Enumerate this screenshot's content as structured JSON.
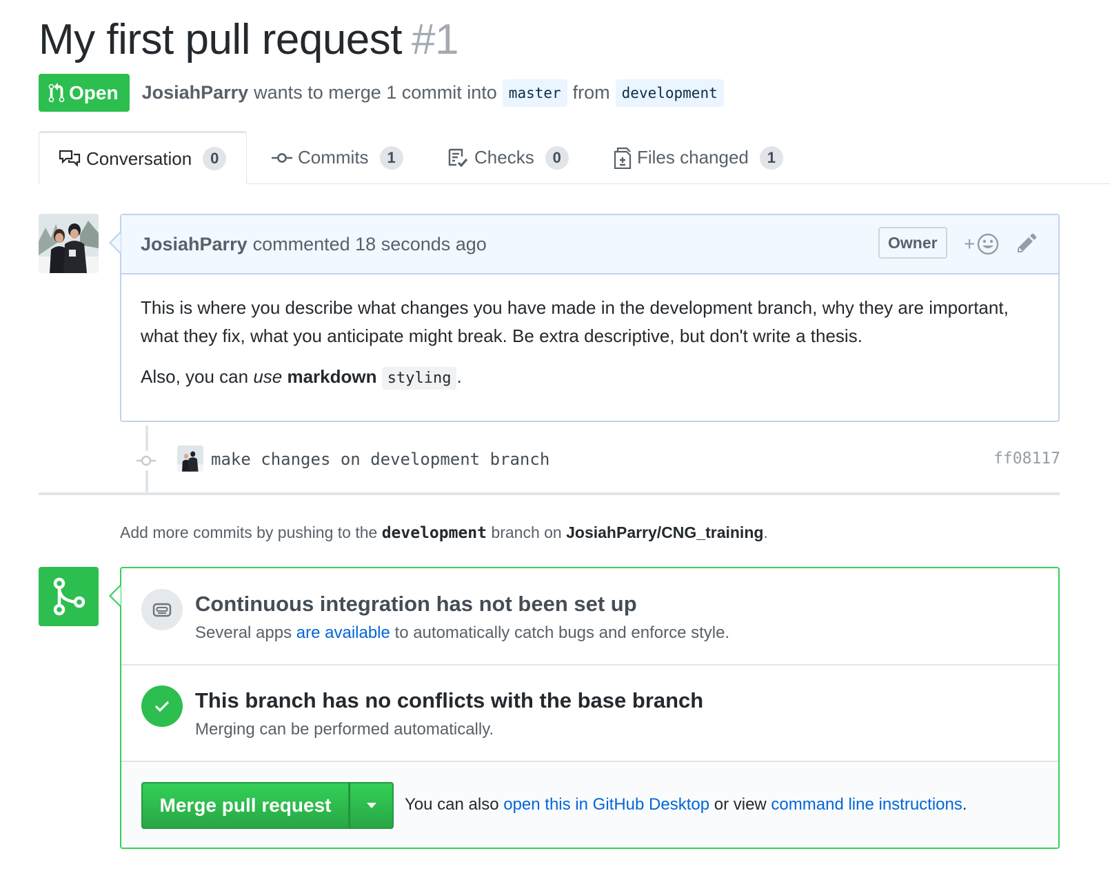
{
  "pr": {
    "title": "My first pull request",
    "number": "#1",
    "state": "Open",
    "author": "JosiahParry",
    "merge_text": "wants to merge 1 commit into",
    "base_branch": "master",
    "from_text": "from",
    "head_branch": "development"
  },
  "tabs": [
    {
      "label": "Conversation",
      "count": "0",
      "icon": "comment-discussion-icon",
      "selected": true
    },
    {
      "label": "Commits",
      "count": "1",
      "icon": "git-commit-icon"
    },
    {
      "label": "Checks",
      "count": "0",
      "icon": "checklist-icon"
    },
    {
      "label": "Files changed",
      "count": "1",
      "icon": "file-diff-icon"
    }
  ],
  "comment": {
    "author": "JosiahParry",
    "action": "commented 18 seconds ago",
    "owner_label": "Owner",
    "reaction_plus": "+",
    "body_paragraph": "This is where you describe what changes you have made in the development branch, why they are important, what they fix, what you anticipate might break. Be extra descriptive, but don't write a thesis.",
    "body_also": "Also, you can ",
    "body_use": "use",
    "body_markdown": "markdown",
    "body_code": "styling",
    "body_period": "."
  },
  "commit": {
    "message": "make changes on development branch",
    "sha": "ff08117"
  },
  "push_hint": {
    "prefix": "Add more commits by pushing to the ",
    "branch": "development",
    "middle": " branch on ",
    "repo": "JosiahParry/CNG_training",
    "suffix": "."
  },
  "merge": {
    "ci_heading": "Continuous integration has not been set up",
    "ci_desc_prefix": "Several apps ",
    "ci_desc_link": "are available",
    "ci_desc_suffix": " to automatically catch bugs and enforce style.",
    "conflict_heading": "This branch has no conflicts with the base branch",
    "conflict_desc": "Merging can be performed automatically.",
    "merge_button": "Merge pull request",
    "alt_prefix": "You can also ",
    "alt_link1": "open this in GitHub Desktop",
    "alt_middle": " or view ",
    "alt_link2": "command line instructions",
    "alt_suffix": "."
  },
  "colors": {
    "open_green": "#2cbe4e",
    "link_blue": "#0366d6",
    "comment_header_bg": "#f1f8ff",
    "comment_border": "#c0d3eb",
    "merge_border": "#34d058"
  }
}
